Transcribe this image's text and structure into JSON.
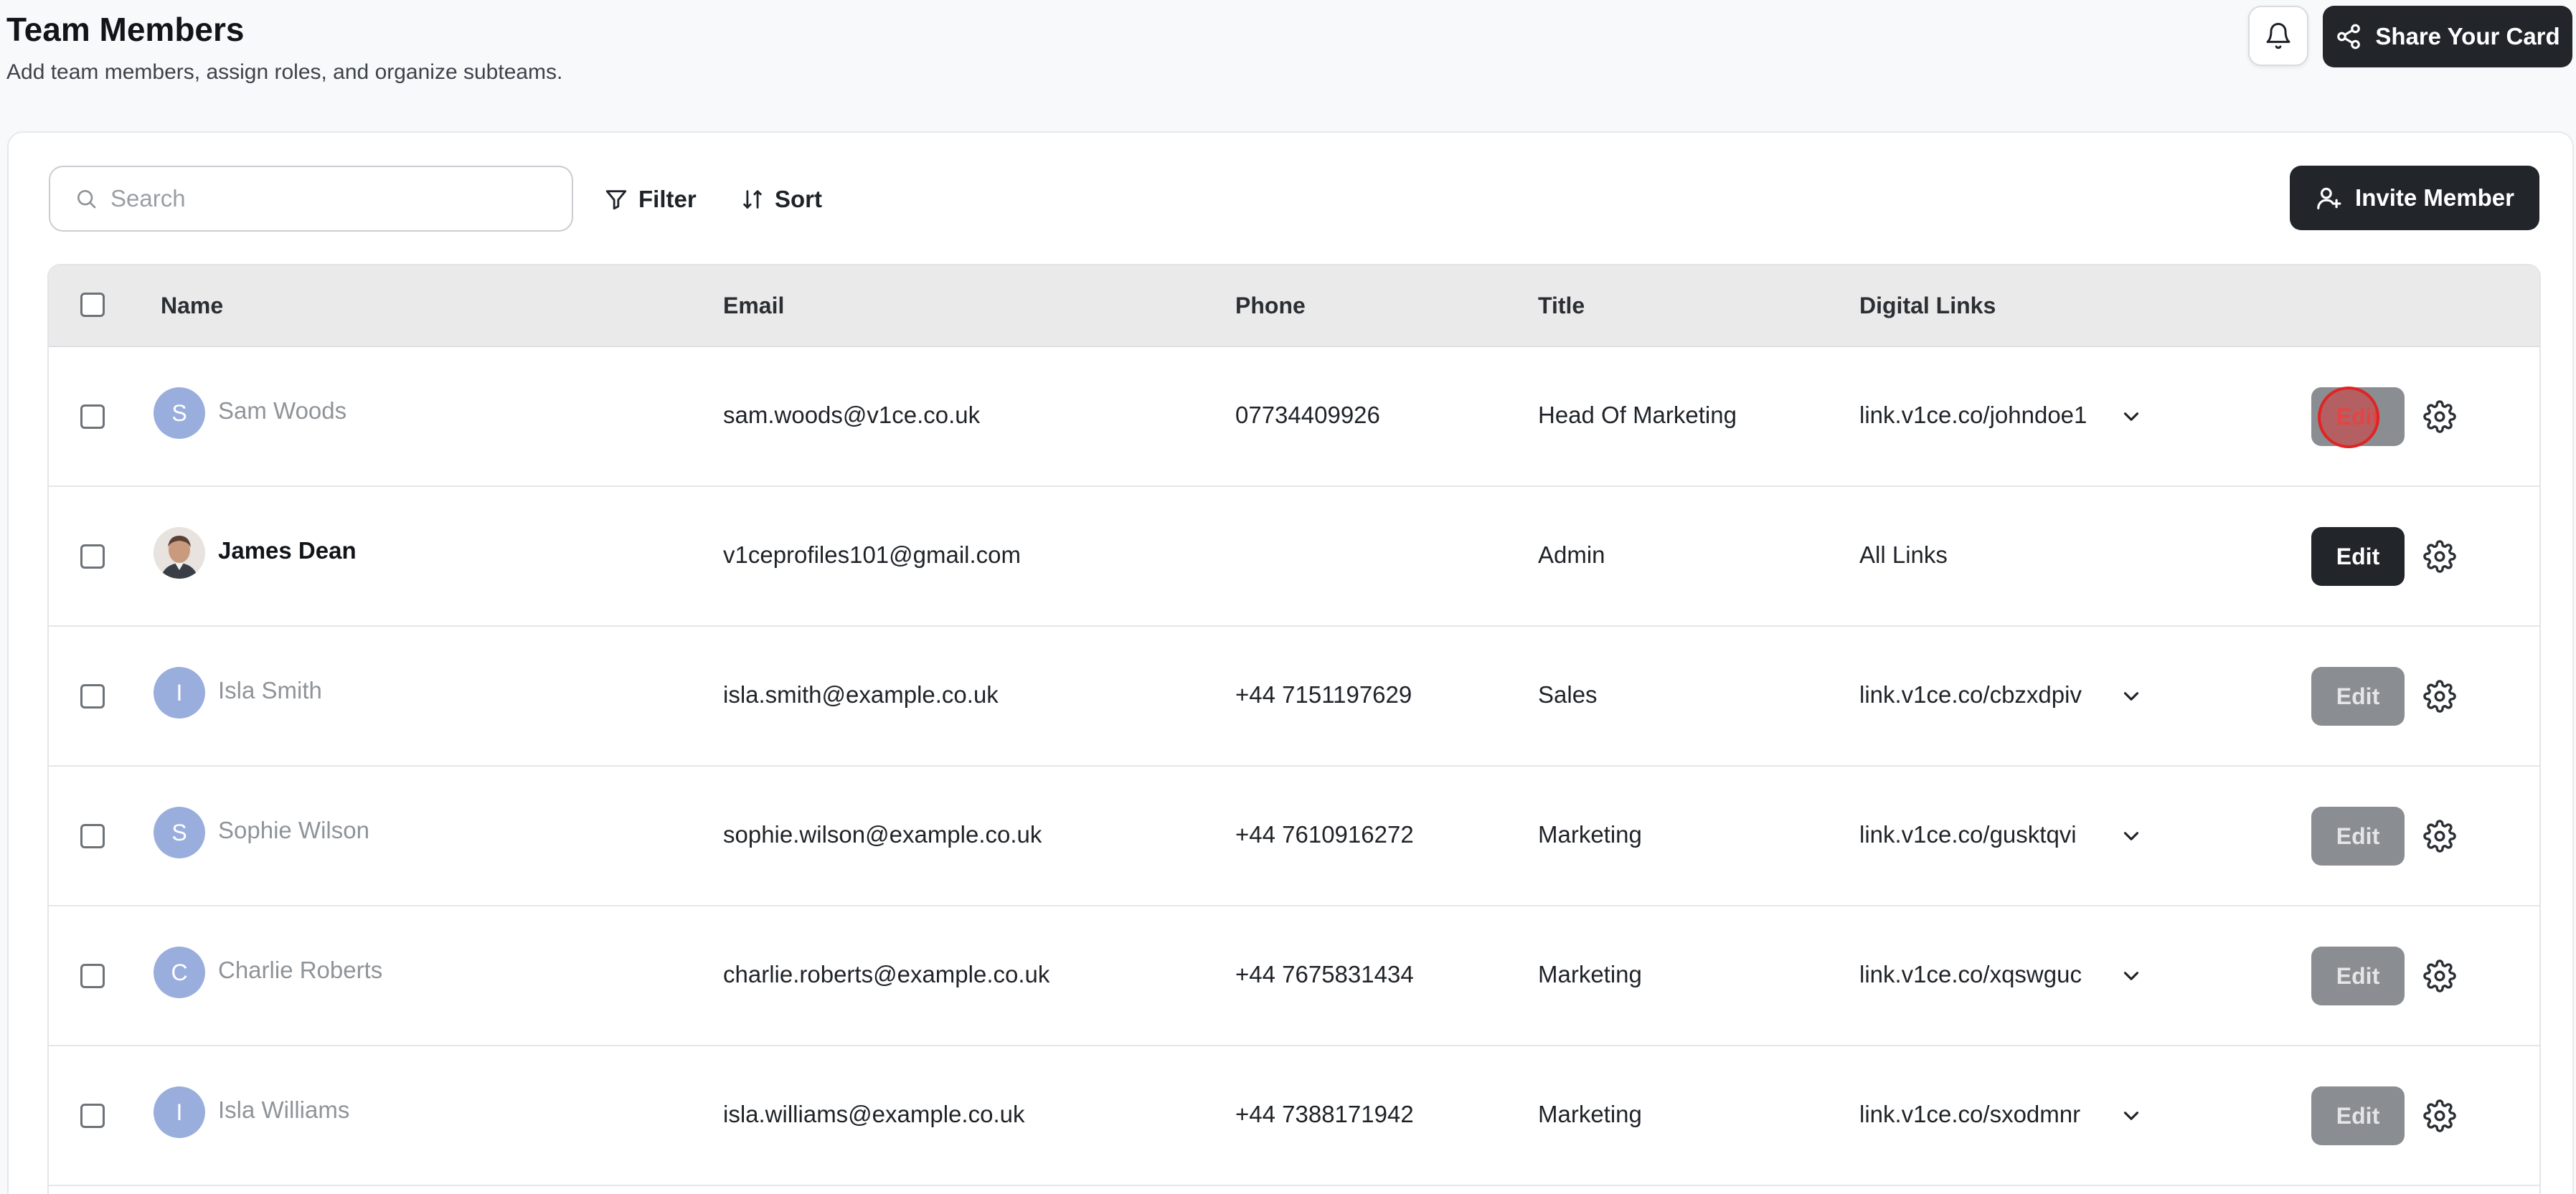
{
  "header": {
    "title": "Team Members",
    "subtitle": "Add team members, assign roles, and organize subteams.",
    "share_label": "Share Your Card"
  },
  "toolbar": {
    "search_placeholder": "Search",
    "filter_label": "Filter",
    "sort_label": "Sort",
    "invite_label": "Invite Member"
  },
  "table": {
    "columns": [
      "Name",
      "Email",
      "Phone",
      "Title",
      "Digital Links"
    ],
    "rows": [
      {
        "initial": "S",
        "name": "Sam Woods",
        "email": "sam.woods@v1ce.co.uk",
        "phone": "07734409926",
        "title": "Head Of Marketing",
        "link": "link.v1ce.co/johndoe1",
        "edit": "Edit",
        "has_dropdown": true,
        "state": "hover"
      },
      {
        "initial": "",
        "name": "James Dean",
        "email": "v1ceprofiles101@gmail.com",
        "phone": "",
        "title": "Admin",
        "link": "All Links",
        "edit": "Edit",
        "has_dropdown": false,
        "state": "active"
      },
      {
        "initial": "I",
        "name": "Isla Smith",
        "email": "isla.smith@example.co.uk",
        "phone": "+44 7151197629",
        "title": "Sales",
        "link": "link.v1ce.co/cbzxdpiv",
        "edit": "Edit",
        "has_dropdown": true,
        "state": "normal"
      },
      {
        "initial": "S",
        "name": "Sophie Wilson",
        "email": "sophie.wilson@example.co.uk",
        "phone": "+44 7610916272",
        "title": "Marketing",
        "link": "link.v1ce.co/gusktqvi",
        "edit": "Edit",
        "has_dropdown": true,
        "state": "normal"
      },
      {
        "initial": "C",
        "name": "Charlie Roberts",
        "email": "charlie.roberts@example.co.uk",
        "phone": "+44 7675831434",
        "title": "Marketing",
        "link": "link.v1ce.co/xqswguc",
        "edit": "Edit",
        "has_dropdown": true,
        "state": "normal"
      },
      {
        "initial": "I",
        "name": "Isla Williams",
        "email": "isla.williams@example.co.uk",
        "phone": "+44 7388171942",
        "title": "Marketing",
        "link": "link.v1ce.co/sxodmnr",
        "edit": "Edit",
        "has_dropdown": true,
        "state": "normal"
      }
    ]
  },
  "colors": {
    "primary_dark": "#22262b",
    "avatar_blue": "#9aaedd",
    "disabled_button": "#8a8d91",
    "click_highlight": "#e02424"
  },
  "icons": [
    "bell-icon",
    "share-icon",
    "search-icon",
    "filter-icon",
    "sort-icon",
    "user-plus-icon",
    "chevron-down-icon",
    "gear-icon"
  ]
}
